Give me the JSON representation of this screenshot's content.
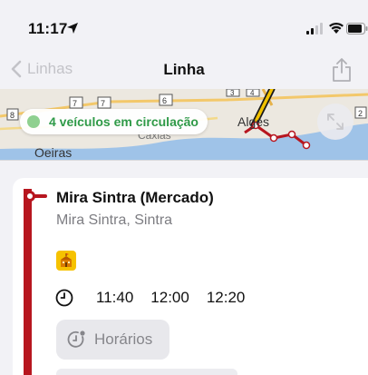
{
  "status_bar": {
    "time": "11:17",
    "icons": [
      "location-arrow-icon",
      "cellular-signal-icon",
      "wifi-icon",
      "battery-icon"
    ]
  },
  "nav": {
    "back_label": "Linhas",
    "title": "Linha",
    "share_icon": "share-icon"
  },
  "map": {
    "vehicles_text": "4 veículos em circulação",
    "labels": {
      "oeiras": "Oeiras",
      "alges": "Algés",
      "caxias": "Caxias"
    },
    "road_numbers": [
      "7",
      "7",
      "6",
      "3",
      "4",
      "8",
      "2"
    ]
  },
  "stop": {
    "name": "Mira Sintra (Mercado)",
    "area": "Mira Sintra, Sintra",
    "facility_icon": "school-icon",
    "times": [
      "11:40",
      "12:00",
      "12:20"
    ],
    "schedule_label": "Horários"
  },
  "colors": {
    "line_color": "#b7161f",
    "vehicles_green": "#2f9a48",
    "badge_yellow": "#f6c200"
  }
}
